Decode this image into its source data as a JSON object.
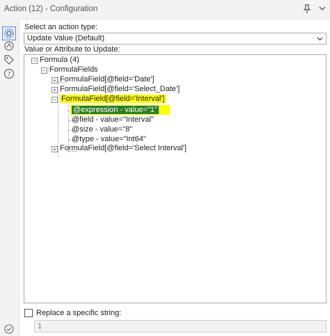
{
  "window": {
    "title": "Action (12) - Configuration"
  },
  "icons": {
    "pin": "pin-icon",
    "menu": "chevron-down-icon",
    "sidebar": [
      "gear-icon",
      "connection-icon",
      "tag-icon",
      "help-icon"
    ],
    "status": "check-circle-icon"
  },
  "action_type": {
    "label": "Select an action type:",
    "selected": "Update Value (Default)"
  },
  "tree": {
    "label": "Value or Attribute to Update:",
    "nodes": [
      "Formula (4)",
      "FormulaFields",
      "FormulaField[@field='Date']",
      "FormulaField[@field='Select_Date']",
      "FormulaField[@field='Interval']",
      "@expression - value=\"1\"",
      "@field - value=\"Interval\"",
      "@size - value=\"8\"",
      "@type - value=\"Int64\"",
      "FormulaField[@field='Select Interval']"
    ]
  },
  "replace": {
    "label": "Replace a specific string:",
    "checked": false,
    "value": "1"
  },
  "colors": {
    "highlight_outer": "#ffff00",
    "highlight_inner": "#2d7d21",
    "selected_tool_border": "#5b8bd6"
  }
}
